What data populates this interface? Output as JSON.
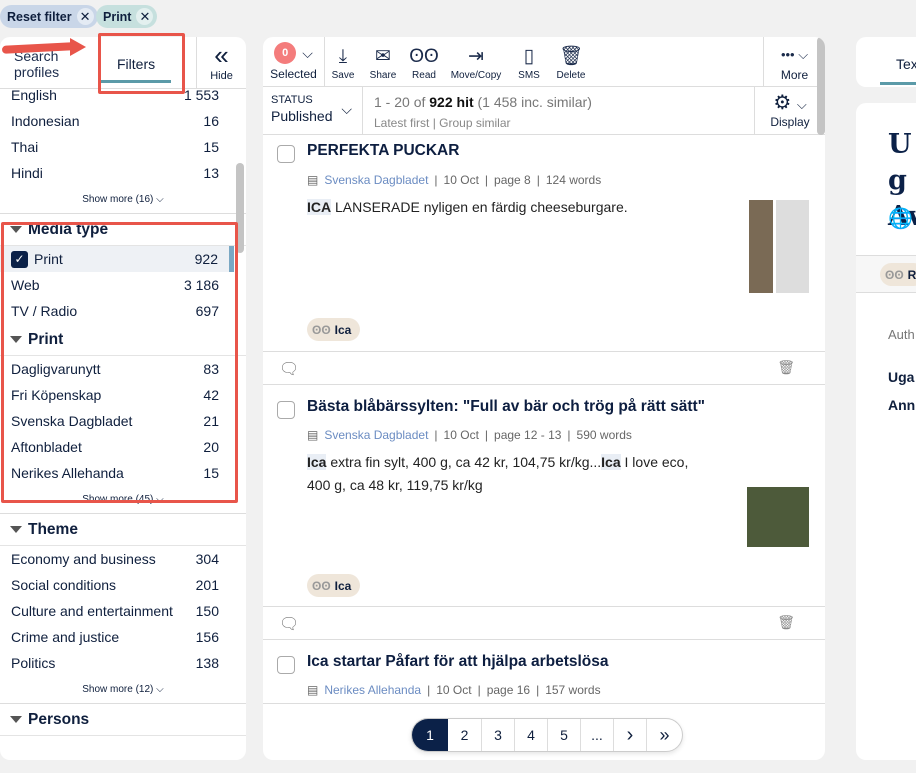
{
  "filter_chips": [
    {
      "label": "Reset filter",
      "color": "#c9d6e8"
    },
    {
      "label": "Print",
      "color": "#c6e0de"
    }
  ],
  "left": {
    "tabs": {
      "search_profiles": "Search profiles",
      "filters": "Filters",
      "hide": "Hide"
    },
    "language": [
      {
        "label": "English",
        "count": "1 553"
      },
      {
        "label": "Indonesian",
        "count": "16"
      },
      {
        "label": "Thai",
        "count": "15"
      },
      {
        "label": "Hindi",
        "count": "13"
      }
    ],
    "language_more": "Show more (16)",
    "media_type": {
      "title": "Media type",
      "items": [
        {
          "label": "Print",
          "count": "922",
          "checked": true
        },
        {
          "label": "Web",
          "count": "3 186"
        },
        {
          "label": "TV / Radio",
          "count": "697"
        }
      ]
    },
    "print": {
      "title": "Print",
      "items": [
        {
          "label": "Dagligvarunytt",
          "count": "83"
        },
        {
          "label": "Fri Köpenskap",
          "count": "42"
        },
        {
          "label": "Svenska Dagbladet",
          "count": "21"
        },
        {
          "label": "Aftonbladet",
          "count": "20"
        },
        {
          "label": "Nerikes Allehanda",
          "count": "15"
        }
      ],
      "more": "Show more (45)"
    },
    "theme": {
      "title": "Theme",
      "items": [
        {
          "label": "Economy and business",
          "count": "304"
        },
        {
          "label": "Social conditions",
          "count": "201"
        },
        {
          "label": "Culture and entertainment",
          "count": "150"
        },
        {
          "label": "Crime and justice",
          "count": "156"
        },
        {
          "label": "Politics",
          "count": "138"
        }
      ],
      "more": "Show more (12)"
    },
    "persons": {
      "title": "Persons"
    }
  },
  "toolbar": {
    "selected_count": "0",
    "selected": "Selected",
    "save": "Save",
    "share": "Share",
    "read": "Read",
    "move": "Move/Copy",
    "sms": "SMS",
    "delete": "Delete",
    "more": "More",
    "accent": "#f47c7c"
  },
  "status": {
    "label": "STATUS",
    "value": "Published",
    "range": "1 - 20 of ",
    "hits": "922 hit",
    "similar": " (1 458 inc. similar)",
    "sort": "Latest first",
    "group": "Group similar",
    "display": "Display"
  },
  "articles": [
    {
      "title": "PERFEKTA PUCKAR",
      "source": "Svenska Dagbladet",
      "date": "10 Oct",
      "page": "page 8",
      "words": "124 words",
      "hl": "ICA",
      "text": " LANSERADE nyligen en färdig cheeseburgare.",
      "tag": "Ica"
    },
    {
      "title": "Bästa blåbärssylten: \"Full av bär och trög på rätt sätt\"",
      "source": "Svenska Dagbladet",
      "date": "10 Oct",
      "page": "page 12 - 13",
      "words": "590 words",
      "hl": "Ica",
      "text": " extra fin sylt, 400 g, ca 42 kr, 104,75 kr/kg...",
      "hl2": "Ica",
      "text2": " I love eco, 400 g, ca 48 kr, 119,75 kr/kg",
      "tag": "Ica"
    },
    {
      "title": "Ica startar Påfart för att hjälpa arbetslösa",
      "source": "Nerikes Allehanda",
      "date": "10 Oct",
      "page": "page 16",
      "words": "157 words"
    }
  ],
  "pagination": [
    "1",
    "2",
    "3",
    "4",
    "5",
    "...",
    "›",
    "»"
  ],
  "right": {
    "tab": "Tex",
    "title": "Ug Av",
    "tag": "Re",
    "author_label": "Auth",
    "author1": "Uga",
    "author2": "Ann"
  }
}
